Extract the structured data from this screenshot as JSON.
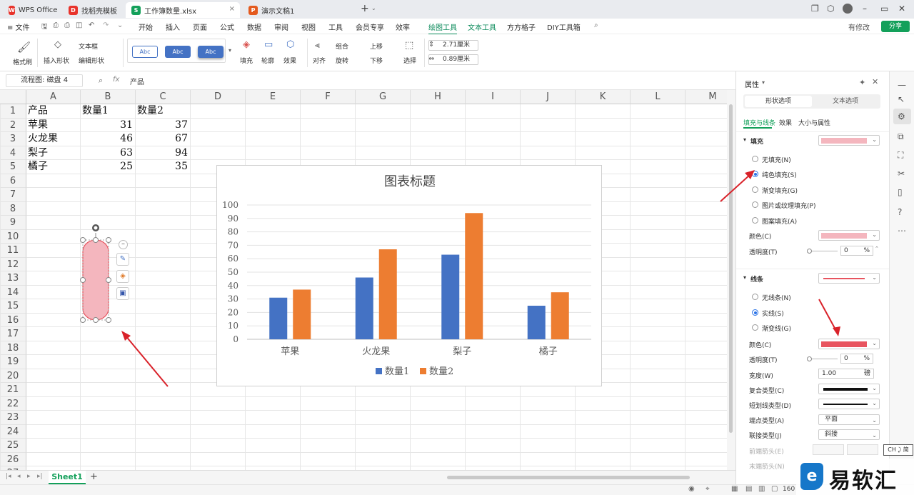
{
  "tabs": [
    {
      "label": "WPS Office",
      "icon": "W",
      "color": "#e8332b"
    },
    {
      "label": "找稻壳模板",
      "icon": "D",
      "color": "#e8332b"
    },
    {
      "label": "工作簿数量.xlsx",
      "icon": "S",
      "color": "#13a05a",
      "close": "×"
    },
    {
      "label": "演示文稿1",
      "icon": "P",
      "color": "#e45a1e"
    }
  ],
  "tab_add": "+",
  "menu": {
    "file": "≡ 文件",
    "items": [
      "开始",
      "插入",
      "页面",
      "公式",
      "数据",
      "审阅",
      "视图",
      "工具",
      "会员专享",
      "效率",
      "绘图工具",
      "文本工具",
      "方方格子",
      "DIY工具箱"
    ],
    "active": "绘图工具",
    "account": "有修改",
    "share": "分享"
  },
  "ribbon": {
    "format_brush": "格式刷",
    "insert_shape": "插入形状",
    "text_box": "文本框",
    "edit_shape": "编辑形状",
    "style_sample": "Abc",
    "fill": "填充",
    "outline": "轮廓",
    "effect": "效果",
    "align": "对齐",
    "group": "组合",
    "rotate": "旋转",
    "up": "上移",
    "down": "下移",
    "select": "选择",
    "height": "2.71厘米",
    "width": "0.89厘米"
  },
  "formula_bar": {
    "name_box": "流程图: 磁盘 4",
    "fx": "fx",
    "content": "产品"
  },
  "grid": {
    "columns": [
      "A",
      "B",
      "C",
      "D",
      "E",
      "F",
      "G",
      "H",
      "I",
      "J",
      "K",
      "L",
      "M"
    ],
    "rows": [
      "1",
      "2",
      "3",
      "4",
      "5",
      "6",
      "7",
      "8",
      "9",
      "10",
      "11",
      "12",
      "13",
      "14",
      "15",
      "16",
      "17",
      "18",
      "19",
      "20",
      "21",
      "22",
      "23",
      "24",
      "25",
      "26",
      "27"
    ],
    "header_row": [
      "产品",
      "数量1",
      "数量2"
    ],
    "data": [
      [
        "苹果",
        "31",
        "37"
      ],
      [
        "火龙果",
        "46",
        "67"
      ],
      [
        "梨子",
        "63",
        "94"
      ],
      [
        "橘子",
        "25",
        "35"
      ]
    ]
  },
  "chart_data": {
    "type": "bar",
    "title": "图表标题",
    "categories": [
      "苹果",
      "火龙果",
      "梨子",
      "橘子"
    ],
    "series": [
      {
        "name": "数量1",
        "values": [
          31,
          46,
          63,
          25
        ],
        "color": "#4472c4"
      },
      {
        "name": "数量2",
        "values": [
          37,
          67,
          94,
          35
        ],
        "color": "#ed7d31"
      }
    ],
    "ylim": [
      0,
      100
    ],
    "yticks": [
      "0",
      "10",
      "20",
      "30",
      "40",
      "50",
      "60",
      "70",
      "80",
      "90",
      "100"
    ],
    "grid": true,
    "legend": "bottom"
  },
  "shape": {
    "fill": "#f4b6be",
    "stroke": "#e8545f"
  },
  "sheets": {
    "tabs": [
      "Sheet1"
    ],
    "add": "+"
  },
  "panel": {
    "title": "属性",
    "tabs": [
      "形状选项",
      "文本选项"
    ],
    "subtabs": [
      "填充与线条",
      "效果",
      "大小与属性"
    ],
    "fill_section": "填充",
    "fill_options": [
      "无填充(N)",
      "纯色填充(S)",
      "渐变填充(G)",
      "图片或纹理填充(P)",
      "图案填充(A)"
    ],
    "fill_selected": 1,
    "color_label": "颜色(C)",
    "transparency_label": "透明度(T)",
    "transparency_value": "0",
    "percent": "%",
    "line_section": "线条",
    "line_options": [
      "无线条(N)",
      "实线(S)",
      "渐变线(G)"
    ],
    "line_selected": 1,
    "line_color_label": "颜色(C)",
    "line_transparency_label": "透明度(T)",
    "line_transparency_value": "0",
    "width_label": "宽度(W)",
    "width_value": "1.00",
    "width_unit": "磅",
    "compound_label": "复合类型(C)",
    "dash_label": "短划线类型(D)",
    "cap_label": "端点类型(A)",
    "cap_value": "平面",
    "join_label": "联接类型(J)",
    "join_value": "斜接",
    "begin_arrow_label": "前端箭头(E)",
    "end_arrow_label": "末端箭头(N)"
  },
  "ime": "CH ⤸ 简",
  "watermark": "易软汇",
  "status": {
    "zoom": "160"
  }
}
